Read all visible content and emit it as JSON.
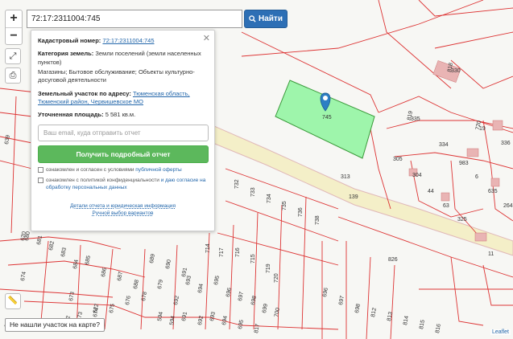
{
  "map": {
    "parcels": [
      "330",
      "335",
      "19",
      "336",
      "334",
      "305",
      "983",
      "304",
      "6",
      "635",
      "44",
      "63",
      "264",
      "325",
      "11",
      "826",
      "313",
      "139",
      "732",
      "733",
      "734",
      "735",
      "736",
      "738",
      "717",
      "716",
      "715",
      "719",
      "720",
      "714",
      "689",
      "690",
      "691",
      "692",
      "693",
      "694",
      "695",
      "696",
      "697",
      "698",
      "699",
      "700",
      "688",
      "687",
      "686",
      "685",
      "684",
      "683",
      "682",
      "681",
      "680",
      "679",
      "678",
      "676",
      "675",
      "674",
      "673",
      "672",
      "671",
      "678",
      "676",
      "675",
      "674",
      "673",
      "622",
      "633",
      "639",
      "620",
      "594",
      "594",
      "691",
      "692",
      "693",
      "694",
      "695",
      "696",
      "697",
      "698",
      "812",
      "813",
      "814",
      "815",
      "816",
      "817",
      "818",
      "819",
      "720"
    ],
    "selected_label": "745",
    "attribution": "Leaflet"
  },
  "controls": {
    "zoom_in": "+",
    "zoom_out": "−",
    "fullscreen_icon": "⤢",
    "print_icon": "⎙",
    "ruler_icon": "📏"
  },
  "search": {
    "value": "72:17:2311004:745",
    "button_label": "Найти"
  },
  "info": {
    "cadastral_label": "Кадастровый номер:",
    "cadastral_value": "72:17:2311004:745",
    "category_label": "Категория земель:",
    "category_value": "Земли поселений (земли населенных пунктов)",
    "usage": "Магазины; Бытовое обслуживание; Объекты культурно-досуговой деятельности",
    "address_label": "Земельный участок по адресу:",
    "address_value": "Тюменская область, Тюменский район, Червишевское МО",
    "area_label": "Уточненная площадь:",
    "area_value": "5 581 кв.м.",
    "email_placeholder": "Ваш email, куда отправить отчет",
    "report_button": "Получить подробный отчет",
    "consent1_text": "ознакомлен и согласен с условиями",
    "consent1_link": "публичной оферты",
    "consent2_text": "ознакомлен с политикой конфиденциальности",
    "consent2_link": "и даю согласие на обработку персональных данных",
    "details_link": "Детали отчета и юридическая информация",
    "manual_link": "Ручной выбор вариантов"
  },
  "bottom": {
    "not_found": "Не нашли участок на карте?"
  }
}
